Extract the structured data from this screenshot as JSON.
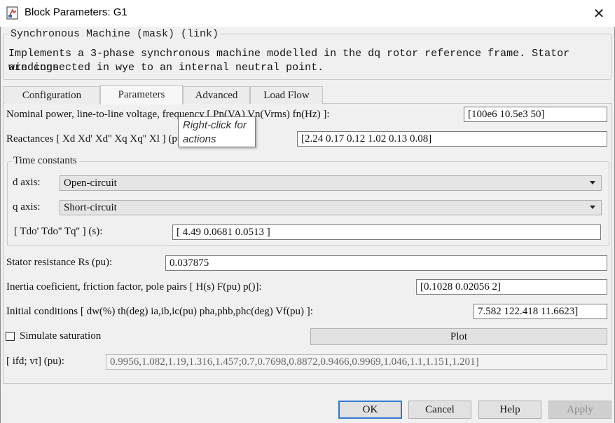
{
  "window": {
    "title": "Block Parameters: G1",
    "close_glyph": "✕",
    "icon": "block-parameters-icon"
  },
  "description": {
    "group_title": "Synchronous Machine (mask) (link)",
    "text_line1": "Implements a 3-phase synchronous machine modelled in the dq rotor reference frame. Stator windings",
    "text_line2": "are connected in wye to an internal neutral point."
  },
  "tabs": [
    {
      "label": "Configuration",
      "active": false
    },
    {
      "label": "Parameters",
      "active": true
    },
    {
      "label": "Advanced",
      "active": false
    },
    {
      "label": "Load Flow",
      "active": false
    }
  ],
  "params": {
    "nominal_label": "Nominal power, line-to-line voltage, frequency [ Pn(VA)  Vn(Vrms)  fn(Hz) ]:",
    "nominal_value": "[100e6 10.5e3 50]",
    "reactances_label": "Reactances [ Xd  Xd'  Xd''  Xq  Xq''  Xl ]  (pu):",
    "reactances_value": "[2.24 0.17 0.12 1.02 0.13 0.08]",
    "time_constants": {
      "group_title": "Time constants",
      "d_axis_label": "d axis:",
      "d_axis_value": "Open-circuit",
      "q_axis_label": "q axis:",
      "q_axis_value": "Short-circuit",
      "tau_label": "[ Tdo'  Tdo''  Tq'' ] (s):",
      "tau_value": "[  4.49  0.0681  0.0513  ]"
    },
    "rs_label": "Stator resistance Rs (pu):",
    "rs_value": "0.037875",
    "inertia_label": "Inertia coeficient, friction factor, pole pairs [ H(s)  F(pu)  p()]:",
    "inertia_value": "[0.1028 0.02056 2]",
    "init_label": "Initial conditions [ dw(%)  th(deg)  ia,ib,ic(pu)  pha,phb,phc(deg)  Vf(pu) ]:",
    "init_value": "7.582 122.418 11.6623]",
    "saturation_label": "Simulate saturation",
    "saturation_checked": false,
    "plot_label": "Plot",
    "ifd_label": "[ ifd; vt] (pu):",
    "ifd_value": "0.9956,1.082,1.19,1.316,1.457;0.7,0.7698,0.8872,0.9466,0.9969,1.046,1.1,1.151,1.201]"
  },
  "tooltip": {
    "line1": "Right-click for",
    "line2": "actions"
  },
  "buttons": {
    "ok": "OK",
    "cancel": "Cancel",
    "help": "Help",
    "apply": "Apply"
  },
  "colors": {
    "default_button_border": "#2f7bd6",
    "background": "#f0f0f0"
  }
}
